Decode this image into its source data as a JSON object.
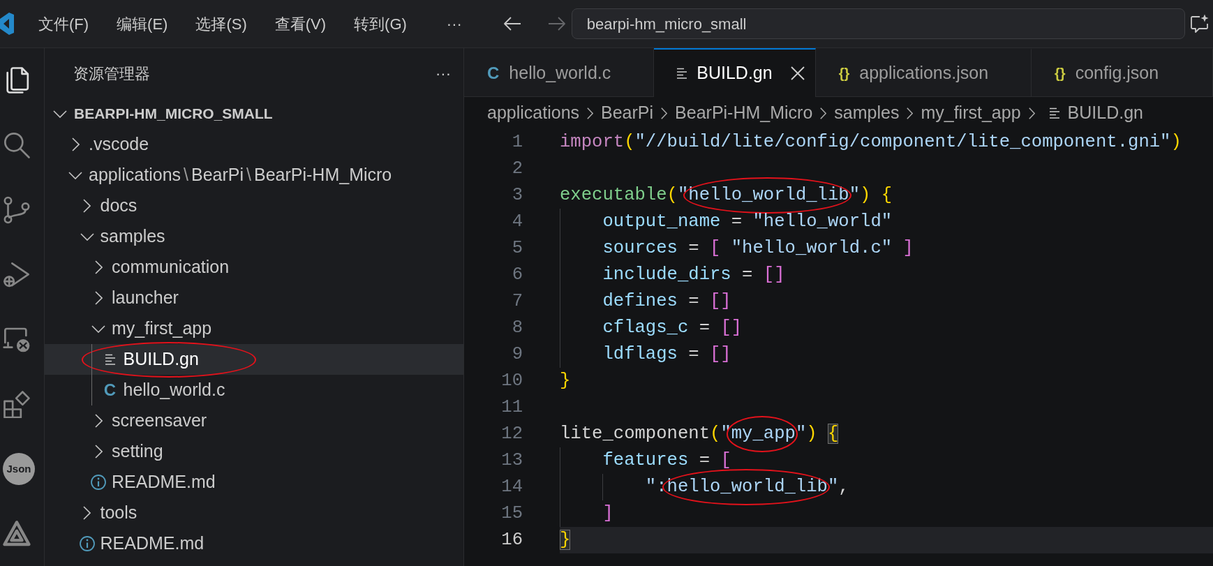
{
  "title_bar": {
    "menus": [
      "文件(F)",
      "编辑(E)",
      "选择(S)",
      "查看(V)",
      "转到(G)"
    ],
    "more": "···",
    "nav": [
      {
        "kind": "back",
        "disabled": false
      },
      {
        "kind": "forward",
        "disabled": true
      }
    ],
    "search": {
      "value": "bearpi-hm_micro_small"
    }
  },
  "activity_bar": [
    {
      "kind": "explorer",
      "selected": true
    },
    {
      "kind": "search",
      "selected": false
    },
    {
      "kind": "git",
      "selected": false
    },
    {
      "kind": "debug",
      "selected": false
    },
    {
      "kind": "remote",
      "selected": false
    },
    {
      "kind": "extensions",
      "selected": false
    },
    {
      "kind": "badge",
      "label": "Json",
      "selected": false
    },
    {
      "kind": "logo",
      "selected": false
    }
  ],
  "sidebar": {
    "title": "资源管理器",
    "more": "···",
    "tree": [
      {
        "label": "BEARPI-HM_MICRO_SMALL",
        "kind": "root",
        "expanded": true,
        "selected": false,
        "children": [
          {
            "label": ".vscode",
            "kind": "folder",
            "expanded": false,
            "selected": false
          },
          {
            "label": "applications\\BearPi\\BearPi-HM_Micro",
            "kind": "folder",
            "expanded": true,
            "selected": false,
            "children": [
              {
                "label": "docs",
                "kind": "folder",
                "expanded": false,
                "selected": false
              },
              {
                "label": "samples",
                "kind": "folder",
                "expanded": true,
                "selected": false,
                "children": [
                  {
                    "label": "communication",
                    "kind": "folder",
                    "expanded": false,
                    "selected": false
                  },
                  {
                    "label": "launcher",
                    "kind": "folder",
                    "expanded": false,
                    "selected": false
                  },
                  {
                    "label": "my_first_app",
                    "kind": "folder",
                    "expanded": true,
                    "selected": false,
                    "children": [
                      {
                        "label": "BUILD.gn",
                        "kind": "gn",
                        "selected": true,
                        "circled": true
                      },
                      {
                        "label": "hello_world.c",
                        "kind": "c",
                        "icon": "C",
                        "selected": false
                      }
                    ]
                  },
                  {
                    "label": "screensaver",
                    "kind": "folder",
                    "expanded": false,
                    "selected": false
                  },
                  {
                    "label": "setting",
                    "kind": "folder",
                    "expanded": false,
                    "selected": false
                  },
                  {
                    "label": "README.md",
                    "kind": "md",
                    "selected": false
                  }
                ]
              },
              {
                "label": "tools",
                "kind": "folder",
                "expanded": false,
                "selected": false
              },
              {
                "label": "README.md",
                "kind": "md",
                "selected": false
              }
            ]
          }
        ]
      }
    ]
  },
  "editor": {
    "tabs": [
      {
        "label": "hello_world.c",
        "kind": "c",
        "icon": "C",
        "selected": false
      },
      {
        "label": "BUILD.gn",
        "kind": "gn",
        "selected": true
      },
      {
        "label": "applications.json",
        "kind": "json",
        "icon": "{}",
        "selected": false
      },
      {
        "label": "config.json",
        "kind": "json",
        "icon": "{}",
        "selected": false
      }
    ],
    "breadcrumbs": [
      {
        "label": "applications",
        "kind": "folder"
      },
      {
        "label": "BearPi",
        "kind": "folder"
      },
      {
        "label": "BearPi-HM_Micro",
        "kind": "folder"
      },
      {
        "label": "samples",
        "kind": "folder"
      },
      {
        "label": "my_first_app",
        "kind": "folder"
      },
      {
        "label": "BUILD.gn",
        "kind": "gn"
      }
    ],
    "lines": [
      {
        "number": "1",
        "current": false,
        "tokens": [
          {
            "text": "import",
            "kind": "keyword"
          },
          {
            "text": "(",
            "kind": "paren"
          },
          {
            "text": "\"//build/lite/config/component/lite_component.gni\"",
            "kind": "string"
          },
          {
            "text": ")",
            "kind": "paren"
          }
        ]
      },
      {
        "number": "2",
        "current": false
      },
      {
        "number": "3",
        "current": false,
        "tokens": [
          {
            "text": "executable",
            "kind": "func"
          },
          {
            "text": "(",
            "kind": "paren"
          },
          {
            "text": "\"",
            "kind": "string"
          },
          {
            "text": "hello_world_lib",
            "kind": "string",
            "circled": true
          },
          {
            "text": "\"",
            "kind": "string"
          },
          {
            "text": ") ",
            "kind": "paren"
          },
          {
            "text": "{",
            "kind": "brace"
          }
        ]
      },
      {
        "number": "4",
        "current": false,
        "tokens": [
          {
            "text": "    output_name",
            "kind": "ident"
          },
          {
            "text": " = ",
            "kind": "op"
          },
          {
            "text": "\"hello_world\"",
            "kind": "string"
          }
        ]
      },
      {
        "number": "5",
        "current": false,
        "tokens": [
          {
            "text": "    sources",
            "kind": "ident"
          },
          {
            "text": " = ",
            "kind": "op"
          },
          {
            "text": "[",
            "kind": "bracket"
          },
          {
            "text": " \"hello_world.c\" ",
            "kind": "string"
          },
          {
            "text": "]",
            "kind": "bracket"
          }
        ]
      },
      {
        "number": "6",
        "current": false,
        "tokens": [
          {
            "text": "    include_dirs",
            "kind": "ident"
          },
          {
            "text": " = ",
            "kind": "op"
          },
          {
            "text": "[]",
            "kind": "bracket"
          }
        ]
      },
      {
        "number": "7",
        "current": false,
        "tokens": [
          {
            "text": "    defines",
            "kind": "ident"
          },
          {
            "text": " = ",
            "kind": "op"
          },
          {
            "text": "[]",
            "kind": "bracket"
          }
        ]
      },
      {
        "number": "8",
        "current": false,
        "tokens": [
          {
            "text": "    cflags_c",
            "kind": "ident"
          },
          {
            "text": " = ",
            "kind": "op"
          },
          {
            "text": "[]",
            "kind": "bracket"
          }
        ]
      },
      {
        "number": "9",
        "current": false,
        "tokens": [
          {
            "text": "    ldflags",
            "kind": "ident"
          },
          {
            "text": " = ",
            "kind": "op"
          },
          {
            "text": "[]",
            "kind": "bracket"
          }
        ]
      },
      {
        "number": "10",
        "current": false,
        "tokens": [
          {
            "text": "}",
            "kind": "brace"
          }
        ]
      },
      {
        "number": "11",
        "current": false
      },
      {
        "number": "12",
        "current": false,
        "tokens": [
          {
            "text": "lite_component",
            "kind": "plain"
          },
          {
            "text": "(",
            "kind": "paren"
          },
          {
            "text": "\"",
            "kind": "string"
          },
          {
            "text": "my_app",
            "kind": "string",
            "circled": true
          },
          {
            "text": "\"",
            "kind": "string"
          },
          {
            "text": ") ",
            "kind": "paren"
          },
          {
            "text": "{",
            "kind": "brace",
            "matched": true
          }
        ]
      },
      {
        "number": "13",
        "current": false,
        "tokens": [
          {
            "text": "    features",
            "kind": "ident"
          },
          {
            "text": " = ",
            "kind": "op"
          },
          {
            "text": "[",
            "kind": "bracket"
          }
        ]
      },
      {
        "number": "14",
        "current": false,
        "tokens": [
          {
            "text": "        \":",
            "kind": "string"
          },
          {
            "text": "hello_world_lib",
            "kind": "string",
            "circled": true
          },
          {
            "text": "\"",
            "kind": "string"
          },
          {
            "text": ",",
            "kind": "op"
          }
        ]
      },
      {
        "number": "15",
        "current": false,
        "tokens": [
          {
            "text": "    ]",
            "kind": "bracket"
          }
        ]
      },
      {
        "number": "16",
        "current": true,
        "tokens": [
          {
            "text": "}",
            "kind": "brace",
            "matched": true
          }
        ]
      }
    ]
  }
}
